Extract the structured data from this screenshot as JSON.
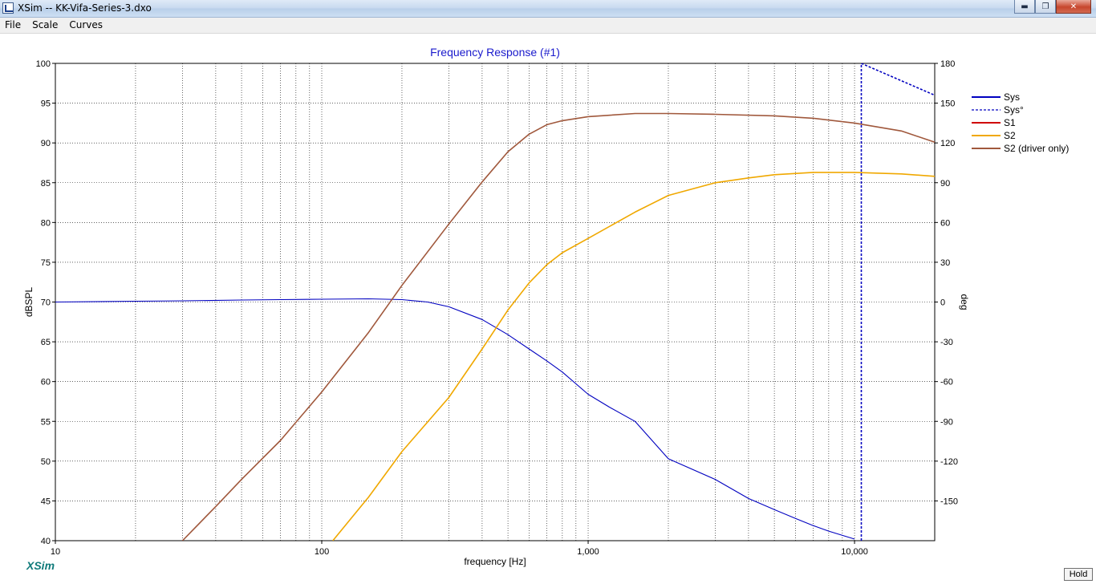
{
  "window": {
    "title": "XSim -- KK-Vifa-Series-3.dxo",
    "controls": {
      "minimize": "▬",
      "maximize": "❐",
      "close": "✕"
    }
  },
  "menu": {
    "items": [
      "File",
      "Scale",
      "Curves"
    ]
  },
  "brand": "XSim",
  "hold_label": "Hold",
  "chart_data": {
    "type": "line",
    "title": "Frequency Response (#1)",
    "xlabel": "frequency [Hz]",
    "ylabel": "dBSPL",
    "y2label": "deg",
    "xscale": "log",
    "xlim": [
      10,
      20000
    ],
    "ylim": [
      40,
      100
    ],
    "y2lim": [
      -180,
      180
    ],
    "grid": true,
    "legend_placement": "right",
    "x_ticks": [
      {
        "value": 10,
        "label": "10"
      },
      {
        "value": 100,
        "label": "100"
      },
      {
        "value": 1000,
        "label": "1,000"
      },
      {
        "value": 10000,
        "label": "10,000"
      }
    ],
    "y_ticks": [
      "100",
      "95",
      "90",
      "85",
      "80",
      "75",
      "70",
      "65",
      "60",
      "55",
      "50",
      "45",
      "40"
    ],
    "y2_ticks": [
      "180",
      "150",
      "120",
      "90",
      "60",
      "30",
      "0",
      "-30",
      "-60",
      "-90",
      "-120",
      "-150"
    ],
    "series": [
      {
        "name": "Sys",
        "color": "#0000c0",
        "style": "solid",
        "axis": "left",
        "points": [
          [
            10,
            70
          ],
          [
            20,
            70.1
          ],
          [
            30,
            70.15
          ],
          [
            50,
            70.25
          ],
          [
            70,
            70.3
          ],
          [
            100,
            70.35
          ],
          [
            150,
            70.4
          ],
          [
            200,
            70.3
          ],
          [
            250,
            70
          ],
          [
            300,
            69.4
          ],
          [
            400,
            67.8
          ],
          [
            500,
            65.9
          ],
          [
            600,
            64.1
          ],
          [
            700,
            62.6
          ],
          [
            800,
            61.2
          ],
          [
            1000,
            58.4
          ],
          [
            1200,
            56.8
          ],
          [
            1500,
            55
          ],
          [
            2000,
            50.3
          ],
          [
            3000,
            47.7
          ],
          [
            4000,
            45.3
          ],
          [
            5000,
            43.9
          ],
          [
            6000,
            42.8
          ],
          [
            7000,
            41.9
          ],
          [
            8000,
            41.2
          ],
          [
            10000,
            40.2
          ]
        ]
      },
      {
        "name": "Sys°",
        "color": "#0000c0",
        "style": "dashed",
        "axis": "right",
        "points": [
          [
            10600,
            -180
          ],
          [
            10600,
            180
          ],
          [
            20000,
            156
          ]
        ]
      },
      {
        "name": "S1",
        "color": "#d00000",
        "style": "solid",
        "axis": "left",
        "points": []
      },
      {
        "name": "S2",
        "color": "#f0a800",
        "style": "solid",
        "axis": "left",
        "points": [
          [
            110,
            40
          ],
          [
            150,
            45.5
          ],
          [
            200,
            51.2
          ],
          [
            300,
            58
          ],
          [
            400,
            64.1
          ],
          [
            500,
            69
          ],
          [
            600,
            72.4
          ],
          [
            700,
            74.7
          ],
          [
            800,
            76.2
          ],
          [
            1000,
            78
          ],
          [
            1500,
            81.3
          ],
          [
            2000,
            83.4
          ],
          [
            3000,
            85
          ],
          [
            4000,
            85.6
          ],
          [
            5000,
            86
          ],
          [
            7000,
            86.3
          ],
          [
            10000,
            86.3
          ],
          [
            15000,
            86.1
          ],
          [
            20000,
            85.8
          ]
        ]
      },
      {
        "name": "S2 (driver only)",
        "color": "#a0583c",
        "style": "solid",
        "axis": "left",
        "points": [
          [
            30,
            40
          ],
          [
            40,
            44.3
          ],
          [
            50,
            47.7
          ],
          [
            70,
            52.6
          ],
          [
            100,
            58.7
          ],
          [
            150,
            66.2
          ],
          [
            200,
            72.1
          ],
          [
            300,
            79.8
          ],
          [
            400,
            85.1
          ],
          [
            500,
            88.9
          ],
          [
            600,
            91.1
          ],
          [
            700,
            92.3
          ],
          [
            800,
            92.8
          ],
          [
            1000,
            93.3
          ],
          [
            1500,
            93.7
          ],
          [
            2000,
            93.7
          ],
          [
            3000,
            93.6
          ],
          [
            5000,
            93.4
          ],
          [
            7000,
            93.1
          ],
          [
            10000,
            92.5
          ],
          [
            15000,
            91.5
          ],
          [
            20000,
            90.1
          ]
        ]
      }
    ]
  }
}
